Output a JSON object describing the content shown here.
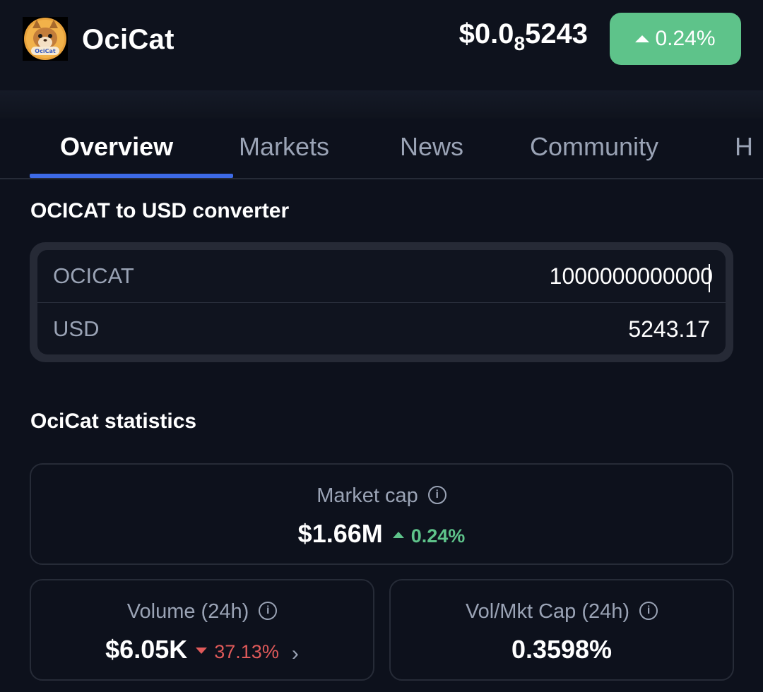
{
  "header": {
    "coin_name": "OciCat",
    "price_prefix": "$0.0",
    "price_zero_count": "8",
    "price_digits": "5243",
    "change": "0.24%",
    "change_color": "#5ec38a"
  },
  "tabs": [
    {
      "label": "Overview",
      "active": true
    },
    {
      "label": "Markets",
      "active": false
    },
    {
      "label": "News",
      "active": false
    },
    {
      "label": "Community",
      "active": false
    },
    {
      "label": "H",
      "active": false
    }
  ],
  "converter": {
    "title": "OCICAT to USD converter",
    "from_label": "OCICAT",
    "from_value": "1000000000000",
    "to_label": "USD",
    "to_value": "5243.17"
  },
  "stats": {
    "title": "OciCat statistics",
    "market_cap": {
      "label": "Market cap",
      "value": "$1.66M",
      "change": "0.24%",
      "direction": "up"
    },
    "volume": {
      "label": "Volume (24h)",
      "value": "$6.05K",
      "change": "37.13%",
      "direction": "down"
    },
    "vol_mkt_cap": {
      "label": "Vol/Mkt Cap (24h)",
      "value": "0.3598%"
    }
  },
  "icons": {
    "info": "info-icon",
    "up": "triangle-up-icon",
    "down": "triangle-down-icon",
    "chevron": "chevron-right-icon"
  },
  "colors": {
    "background": "#0d111c",
    "accent": "#3d6ae6",
    "positive": "#5ec38a",
    "negative": "#e05a5a"
  }
}
